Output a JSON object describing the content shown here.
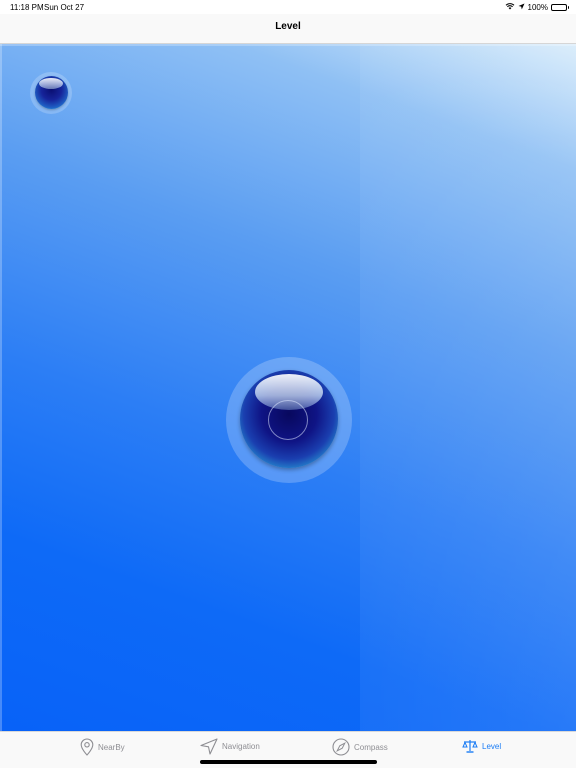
{
  "status_bar": {
    "time": "11:18 PM",
    "date": "Sun Oct 27",
    "battery_text": "100%",
    "battery_level": 1.0,
    "icons": [
      "wifi-icon",
      "location-arrow-icon",
      "battery-icon"
    ]
  },
  "nav": {
    "title": "Level"
  },
  "tabs": [
    {
      "label": "NearBy",
      "icon": "map-pin-icon",
      "active": false
    },
    {
      "label": "Navigation",
      "icon": "navigation-arrow-icon",
      "active": false
    },
    {
      "label": "Compass",
      "icon": "compass-icon",
      "active": false
    },
    {
      "label": "Level",
      "icon": "scale-level-icon",
      "active": true
    }
  ],
  "colors": {
    "accent": "#1a7cf5",
    "inactive_tab": "#8e8e93",
    "level_background": "#0862f8"
  }
}
